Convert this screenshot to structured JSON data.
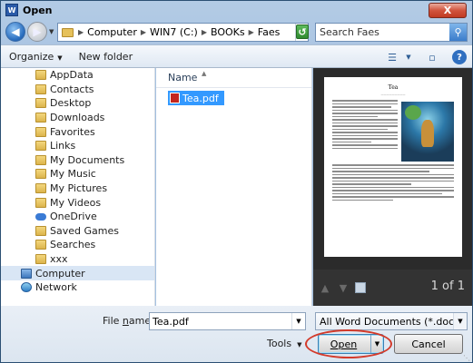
{
  "window": {
    "title": "Open",
    "app_icon_letter": "W",
    "close_glyph": "X"
  },
  "address": {
    "crumbs": [
      "Computer",
      "WIN7 (C:)",
      "BOOKs",
      "Faes"
    ],
    "search_placeholder": "Search Faes"
  },
  "toolbar": {
    "organize": "Organize",
    "new_folder": "New folder"
  },
  "sidebar": {
    "items": [
      {
        "label": "AppData",
        "icon": "folder-icon"
      },
      {
        "label": "Contacts",
        "icon": "folder-icon"
      },
      {
        "label": "Desktop",
        "icon": "folder-icon"
      },
      {
        "label": "Downloads",
        "icon": "folder-icon"
      },
      {
        "label": "Favorites",
        "icon": "folder-icon"
      },
      {
        "label": "Links",
        "icon": "folder-icon"
      },
      {
        "label": "My Documents",
        "icon": "folder-icon"
      },
      {
        "label": "My Music",
        "icon": "folder-icon"
      },
      {
        "label": "My Pictures",
        "icon": "folder-icon"
      },
      {
        "label": "My Videos",
        "icon": "folder-icon"
      },
      {
        "label": "OneDrive",
        "icon": "cloud-icon"
      },
      {
        "label": "Saved Games",
        "icon": "folder-icon"
      },
      {
        "label": "Searches",
        "icon": "folder-icon"
      },
      {
        "label": "xxx",
        "icon": "folder-icon"
      },
      {
        "label": "Computer",
        "icon": "computer-icon",
        "selected": true
      },
      {
        "label": "Network",
        "icon": "network-icon"
      }
    ]
  },
  "files": {
    "column_name": "Name",
    "items": [
      {
        "name": "Tea.pdf",
        "selected": true
      }
    ]
  },
  "preview": {
    "page_title": "Tea",
    "page_count": "1 of 1"
  },
  "bottom": {
    "file_name_label_prefix": "File ",
    "file_name_label_underlined": "n",
    "file_name_label_suffix": "ame:",
    "file_name_value": "Tea.pdf",
    "file_type": "All Word Documents (*.docx;*.d",
    "tools": "Tools",
    "open": "Open",
    "cancel": "Cancel"
  },
  "colors": {
    "selection": "#3399ff",
    "highlight_ring": "#d33a2a",
    "preview_bg": "#2b2b2b"
  }
}
